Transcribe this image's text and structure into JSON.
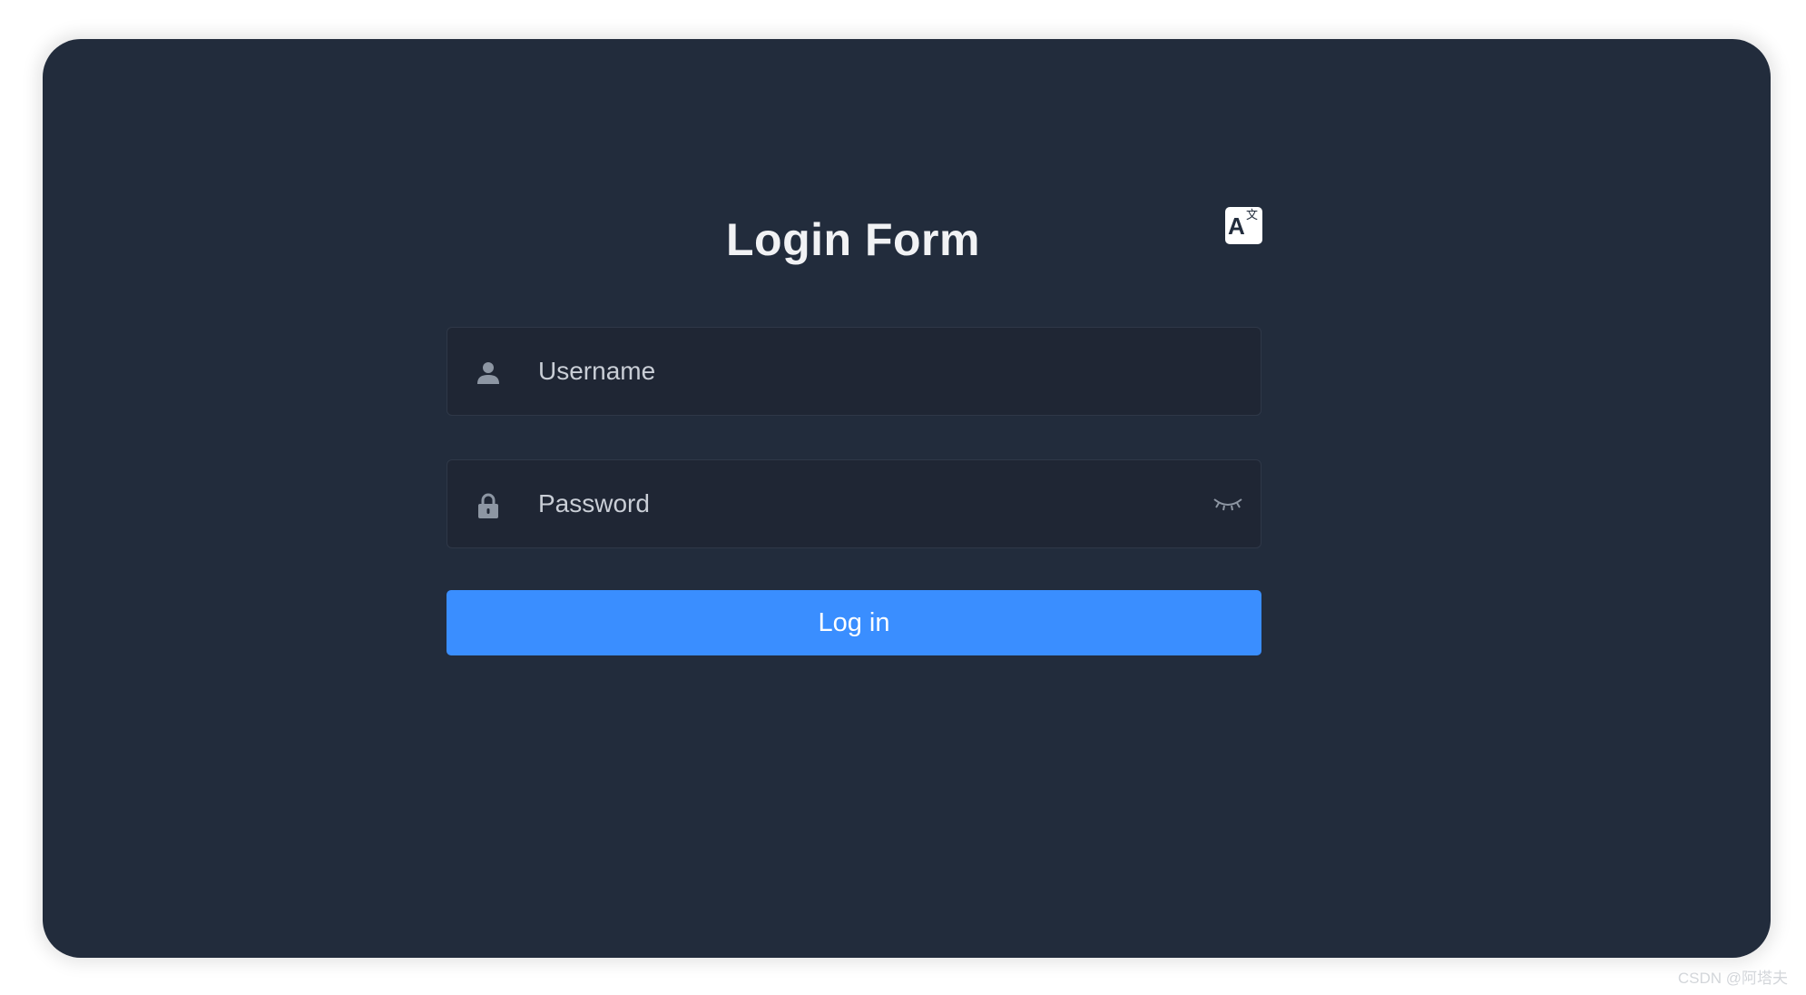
{
  "form": {
    "title": "Login Form",
    "language_button": {
      "icon": "translate-icon",
      "glyph_latin": "A",
      "glyph_cjk": "文"
    },
    "username": {
      "placeholder": "Username",
      "value": "",
      "icon": "user-icon"
    },
    "password": {
      "placeholder": "Password",
      "value": "",
      "icon": "lock-icon",
      "toggle_icon": "eye-closed-icon"
    },
    "login_label": "Log in"
  },
  "watermark": "CSDN @阿塔夫",
  "colors": {
    "background": "#222c3c",
    "field_background": "#1f2634",
    "accent": "#3a8eff",
    "text": "#f1f2f4",
    "icon": "#8d96a3"
  }
}
